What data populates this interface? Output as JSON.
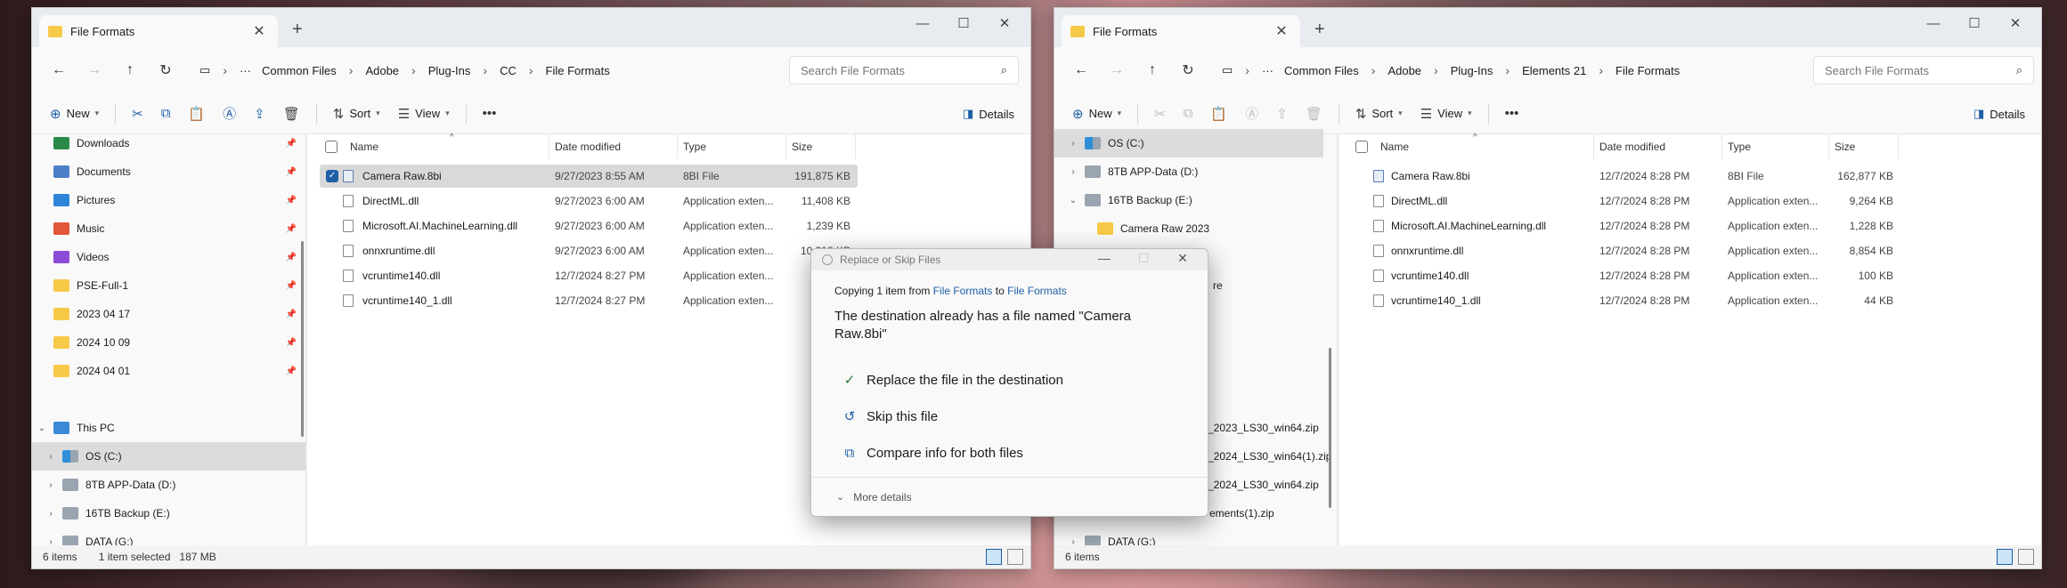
{
  "left": {
    "tab_title": "File Formats",
    "breadcrumb": [
      "Common Files",
      "Adobe",
      "Plug-Ins",
      "CC",
      "File Formats"
    ],
    "search_placeholder": "Search File Formats",
    "toolbar": {
      "new": "New",
      "sort": "Sort",
      "view": "View",
      "details": "Details"
    },
    "nav": [
      {
        "label": "Downloads",
        "pinned": true
      },
      {
        "label": "Documents",
        "pinned": true
      },
      {
        "label": "Pictures",
        "pinned": true
      },
      {
        "label": "Music",
        "pinned": true
      },
      {
        "label": "Videos",
        "pinned": true
      },
      {
        "label": "PSE-Full-1",
        "pinned": true
      },
      {
        "label": "2023 04 17",
        "pinned": true
      },
      {
        "label": "2024 10 09",
        "pinned": true
      },
      {
        "label": "2024 04 01",
        "pinned": true
      },
      {
        "label": "This PC"
      },
      {
        "label": "OS (C:)"
      },
      {
        "label": "8TB APP-Data (D:)"
      },
      {
        "label": "16TB Backup (E:)"
      },
      {
        "label": "DATA (G:)"
      }
    ],
    "columns": [
      "Name",
      "Date modified",
      "Type",
      "Size"
    ],
    "files": [
      {
        "name": "Camera Raw.8bi",
        "date": "9/27/2023 8:55 AM",
        "type": "8BI File",
        "size": "191,875 KB"
      },
      {
        "name": "DirectML.dll",
        "date": "9/27/2023 6:00 AM",
        "type": "Application exten...",
        "size": "11,408 KB"
      },
      {
        "name": "Microsoft.AI.MachineLearning.dll",
        "date": "9/27/2023 6:00 AM",
        "type": "Application exten...",
        "size": "1,239 KB"
      },
      {
        "name": "onnxruntime.dll",
        "date": "9/27/2023 6:00 AM",
        "type": "Application exten...",
        "size": "10,318 KB"
      },
      {
        "name": "vcruntime140.dll",
        "date": "12/7/2024 8:27 PM",
        "type": "Application exten...",
        "size": ""
      },
      {
        "name": "vcruntime140_1.dll",
        "date": "12/7/2024 8:27 PM",
        "type": "Application exten...",
        "size": ""
      }
    ],
    "status": {
      "items": "6 items",
      "selected": "1 item selected",
      "size": "187 MB"
    }
  },
  "right": {
    "tab_title": "File Formats",
    "breadcrumb": [
      "Common Files",
      "Adobe",
      "Plug-Ins",
      "Elements 21",
      "File Formats"
    ],
    "search_placeholder": "Search File Formats",
    "toolbar": {
      "new": "New",
      "sort": "Sort",
      "view": "View",
      "details": "Details"
    },
    "nav": [
      {
        "label": "OS (C:)"
      },
      {
        "label": "8TB APP-Data (D:)"
      },
      {
        "label": "16TB Backup (E:)"
      },
      {
        "label": "Camera Raw 2023"
      },
      {
        "label": "re"
      },
      {
        "label": "_2023_LS30_win64.zip"
      },
      {
        "label": "_2024_LS30_win64(1).zip"
      },
      {
        "label": "_2024_LS30_win64.zip"
      },
      {
        "label": "ements(1).zip"
      },
      {
        "label": "DATA (G:)"
      }
    ],
    "columns": [
      "Name",
      "Date modified",
      "Type",
      "Size"
    ],
    "files": [
      {
        "name": "Camera Raw.8bi",
        "date": "12/7/2024 8:28 PM",
        "type": "8BI File",
        "size": "162,877 KB"
      },
      {
        "name": "DirectML.dll",
        "date": "12/7/2024 8:28 PM",
        "type": "Application exten...",
        "size": "9,264 KB"
      },
      {
        "name": "Microsoft.AI.MachineLearning.dll",
        "date": "12/7/2024 8:28 PM",
        "type": "Application exten...",
        "size": "1,228 KB"
      },
      {
        "name": "onnxruntime.dll",
        "date": "12/7/2024 8:28 PM",
        "type": "Application exten...",
        "size": "8,854 KB"
      },
      {
        "name": "vcruntime140.dll",
        "date": "12/7/2024 8:28 PM",
        "type": "Application exten...",
        "size": "100 KB"
      },
      {
        "name": "vcruntime140_1.dll",
        "date": "12/7/2024 8:28 PM",
        "type": "Application exten...",
        "size": "44 KB"
      }
    ],
    "status": {
      "items": "6 items"
    }
  },
  "dialog": {
    "title": "Replace or Skip Files",
    "copy_prefix": "Copying 1 item from",
    "copy_from": "File Formats",
    "copy_to_word": "to",
    "copy_to": "File Formats",
    "heading": "The destination already has a file named \"Camera Raw.8bi\"",
    "options": [
      "Replace the file in the destination",
      "Skip this file",
      "Compare info for both files"
    ],
    "more": "More details"
  }
}
